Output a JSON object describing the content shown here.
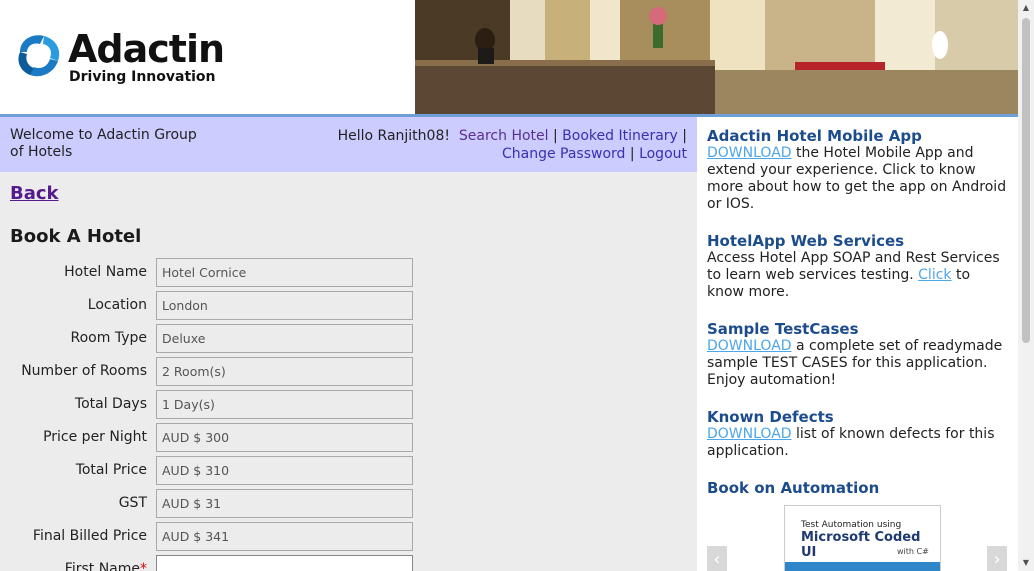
{
  "header": {
    "logo_name": "Adactin",
    "logo_tagline": "Driving Innovation"
  },
  "welcome": {
    "text": "Welcome to Adactin Group of Hotels",
    "greeting": "Hello Ranjith08!",
    "search_hotel": "Search Hotel",
    "booked_itinerary": "Booked Itinerary",
    "change_password": "Change Password",
    "logout": "Logout",
    "sep": "|"
  },
  "main": {
    "back_label": "Back",
    "title": "Book A Hotel",
    "fields": [
      {
        "label": "Hotel Name",
        "value": "Hotel Cornice"
      },
      {
        "label": "Location",
        "value": "London"
      },
      {
        "label": "Room Type",
        "value": "Deluxe"
      },
      {
        "label": "Number of Rooms",
        "value": "2 Room(s)"
      },
      {
        "label": "Total Days",
        "value": "1 Day(s)"
      },
      {
        "label": "Price per Night",
        "value": "AUD $ 300"
      },
      {
        "label": "Total Price",
        "value": "AUD $ 310"
      },
      {
        "label": "GST",
        "value": "AUD $ 31"
      },
      {
        "label": "Final Billed Price",
        "value": "AUD $ 341"
      },
      {
        "label": "First Name",
        "value": ""
      }
    ],
    "required_mark": "*"
  },
  "sidebar": {
    "mobile": {
      "title": "Adactin Hotel Mobile App",
      "link": "DOWNLOAD",
      "text": " the Hotel Mobile App and extend your experience. Click to know more about how to get the app on Android or IOS."
    },
    "webservices": {
      "title": "HotelApp Web Services",
      "text": "Access Hotel App SOAP and Rest Services to learn web services testing. ",
      "link": "Click",
      "text2": " to know more."
    },
    "testcases": {
      "title": "Sample TestCases",
      "link": "DOWNLOAD",
      "text": " a complete set of readymade sample TEST CASES for this application. Enjoy automation!"
    },
    "defects": {
      "title": "Known Defects",
      "link": "DOWNLOAD",
      "text": " list of known defects for this application."
    },
    "book": {
      "title": "Book on Automation",
      "cover_line1": "Test Automation using",
      "cover_line2": "Microsoft Coded UI",
      "cover_line3": "with C#"
    }
  },
  "icons": {
    "prev": "‹",
    "next": "›",
    "scroll_up": "▲",
    "scroll_down": "▼"
  },
  "colors": {
    "welcome_bar": "#ccccff",
    "link": "#3a2fb0",
    "sidebar_title": "#1c4c8c",
    "sidebar_link": "#4da6e8",
    "required": "#dd0000"
  }
}
